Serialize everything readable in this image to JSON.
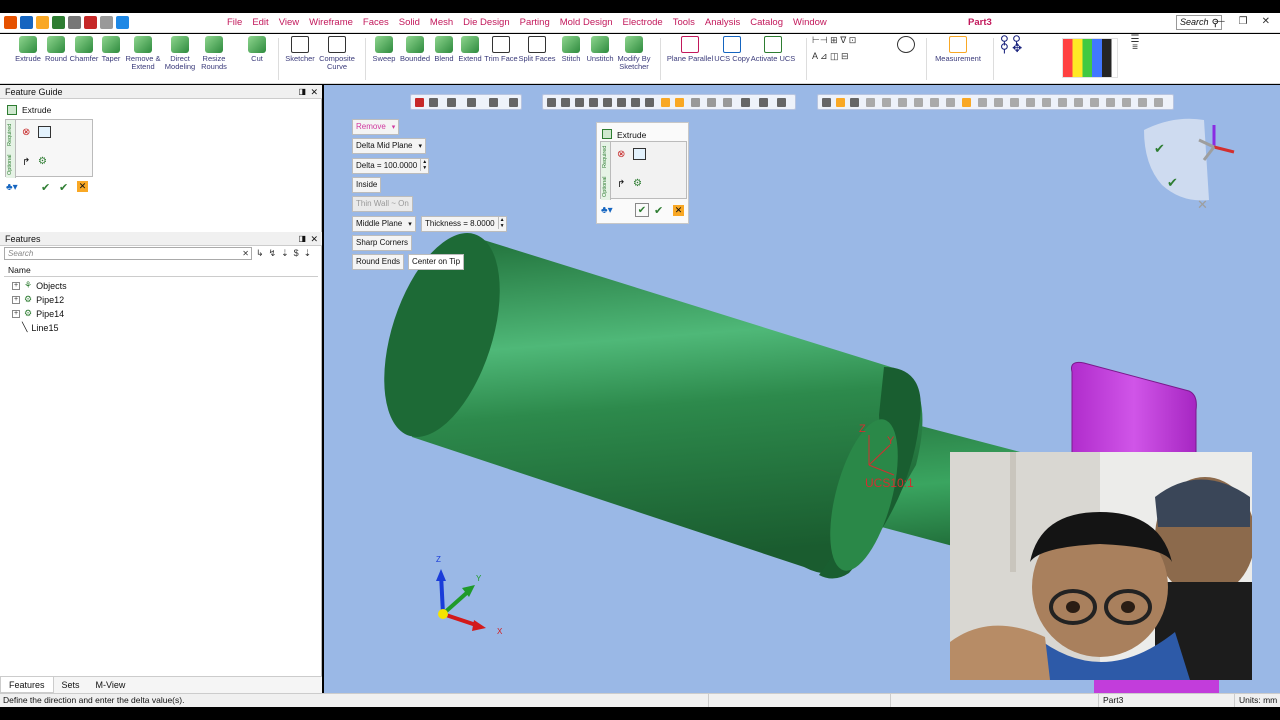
{
  "app": {
    "document_title": "Part3",
    "search_placeholder": "Search"
  },
  "menu": [
    "File",
    "Edit",
    "View",
    "Wireframe",
    "Faces",
    "Solid",
    "Mesh",
    "Die Design",
    "Parting",
    "Mold Design",
    "Electrode",
    "Tools",
    "Analysis",
    "Catalog",
    "Window"
  ],
  "ribbon": {
    "solid_tools": [
      "Extrude",
      "Round",
      "Chamfer",
      "Taper",
      "Remove &\nExtend",
      "Direct\nModeling",
      "Resize\nRounds",
      "Cut"
    ],
    "sketch_tools": [
      "Sketcher",
      "Composite\nCurve"
    ],
    "face_tools": [
      "Sweep",
      "Bounded",
      "Blend",
      "Extend",
      "Trim Face",
      "Split Faces",
      "Stitch",
      "Unstitch",
      "Modify By\nSketcher"
    ],
    "ucs_tools": [
      "Plane Parallel",
      "UCS Copy",
      "Activate UCS"
    ],
    "measurement": "Measurement"
  },
  "feature_guide": {
    "header": "Feature Guide",
    "title": "Extrude",
    "tab_required": "Required",
    "tab_optional": "Optional"
  },
  "features": {
    "header": "Features",
    "search_placeholder": "Search",
    "column_name": "Name",
    "items": [
      {
        "label": "Objects",
        "expandable": true
      },
      {
        "label": "Pipe12",
        "expandable": true
      },
      {
        "label": "Pipe14",
        "expandable": true
      },
      {
        "label": "Line15",
        "expandable": false
      }
    ],
    "tabs": [
      "Features",
      "Sets",
      "M-View"
    ]
  },
  "extrude_controls": {
    "mode": "Remove",
    "direction": "Delta Mid Plane",
    "delta": "Delta = 100.0000",
    "side": "Inside",
    "thin_wall": "Thin Wall ~ On",
    "plane": "Middle Plane",
    "thickness": "Thickness = 8.0000",
    "sharp_corners": "Sharp Corners",
    "round_ends": "Round Ends",
    "center_on_tip": "Center on Tip"
  },
  "extrude_mini": {
    "title": "Extrude",
    "tab_required": "Required",
    "tab_optional": "Optional"
  },
  "viewport": {
    "ucs_label": "UCS10:1",
    "axis_z": "Z",
    "axis_y": "Y",
    "axis_x": "X"
  },
  "status": {
    "message": "Define the direction and enter the delta value(s).",
    "doc": "Part3",
    "units": "Units: mm"
  },
  "colors": {
    "viewport_bg": "#9ab8e6",
    "solid_green": "#2e8b4a",
    "magenta_solid": "#c23ddb",
    "menu_text": "#c2185b"
  }
}
